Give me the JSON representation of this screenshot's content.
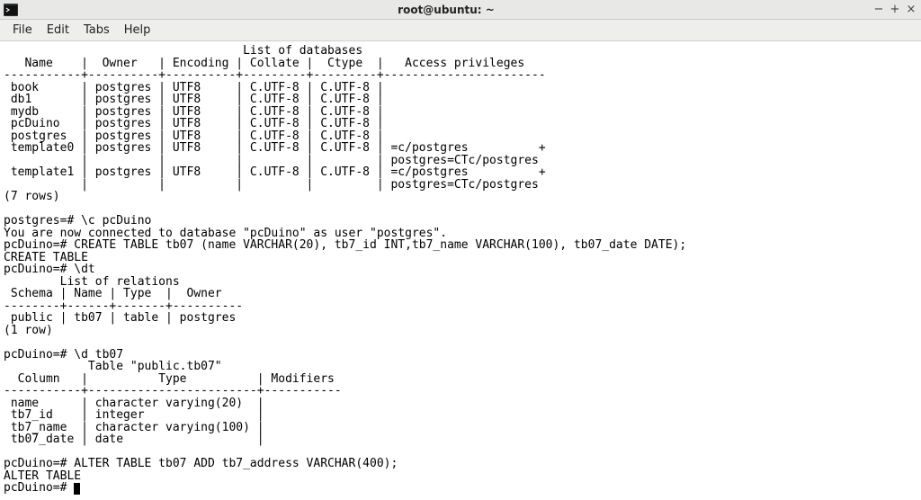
{
  "window": {
    "title": "root@ubuntu: ~",
    "min": "−",
    "max": "+",
    "close": "×"
  },
  "menu": {
    "file": "File",
    "edit": "Edit",
    "tabs": "Tabs",
    "help": "Help"
  },
  "term": {
    "lines": [
      "                                  List of databases",
      "   Name    |  Owner   | Encoding | Collate |  Ctype  |   Access privileges   ",
      "-----------+----------+----------+---------+---------+-----------------------",
      " book      | postgres | UTF8     | C.UTF-8 | C.UTF-8 | ",
      " db1       | postgres | UTF8     | C.UTF-8 | C.UTF-8 | ",
      " mydb      | postgres | UTF8     | C.UTF-8 | C.UTF-8 | ",
      " pcDuino   | postgres | UTF8     | C.UTF-8 | C.UTF-8 | ",
      " postgres  | postgres | UTF8     | C.UTF-8 | C.UTF-8 | ",
      " template0 | postgres | UTF8     | C.UTF-8 | C.UTF-8 | =c/postgres          +",
      "           |          |          |         |         | postgres=CTc/postgres",
      " template1 | postgres | UTF8     | C.UTF-8 | C.UTF-8 | =c/postgres          +",
      "           |          |          |         |         | postgres=CTc/postgres",
      "(7 rows)",
      "",
      "postgres=# \\c pcDuino",
      "You are now connected to database \"pcDuino\" as user \"postgres\".",
      "pcDuino=# CREATE TABLE tb07 (name VARCHAR(20), tb7_id INT,tb7_name VARCHAR(100), tb07_date DATE);",
      "CREATE TABLE",
      "pcDuino=# \\dt",
      "        List of relations",
      " Schema | Name | Type  |  Owner   ",
      "--------+------+-------+----------",
      " public | tb07 | table | postgres",
      "(1 row)",
      "",
      "pcDuino=# \\d tb07",
      "            Table \"public.tb07\"",
      "  Column   |          Type          | Modifiers ",
      "-----------+------------------------+-----------",
      " name      | character varying(20)  | ",
      " tb7_id    | integer                | ",
      " tb7_name  | character varying(100) | ",
      " tb07_date | date                   | ",
      "",
      "pcDuino=# ALTER TABLE tb07 ADD tb7_address VARCHAR(400);",
      "ALTER TABLE"
    ],
    "prompt": "pcDuino=# "
  }
}
